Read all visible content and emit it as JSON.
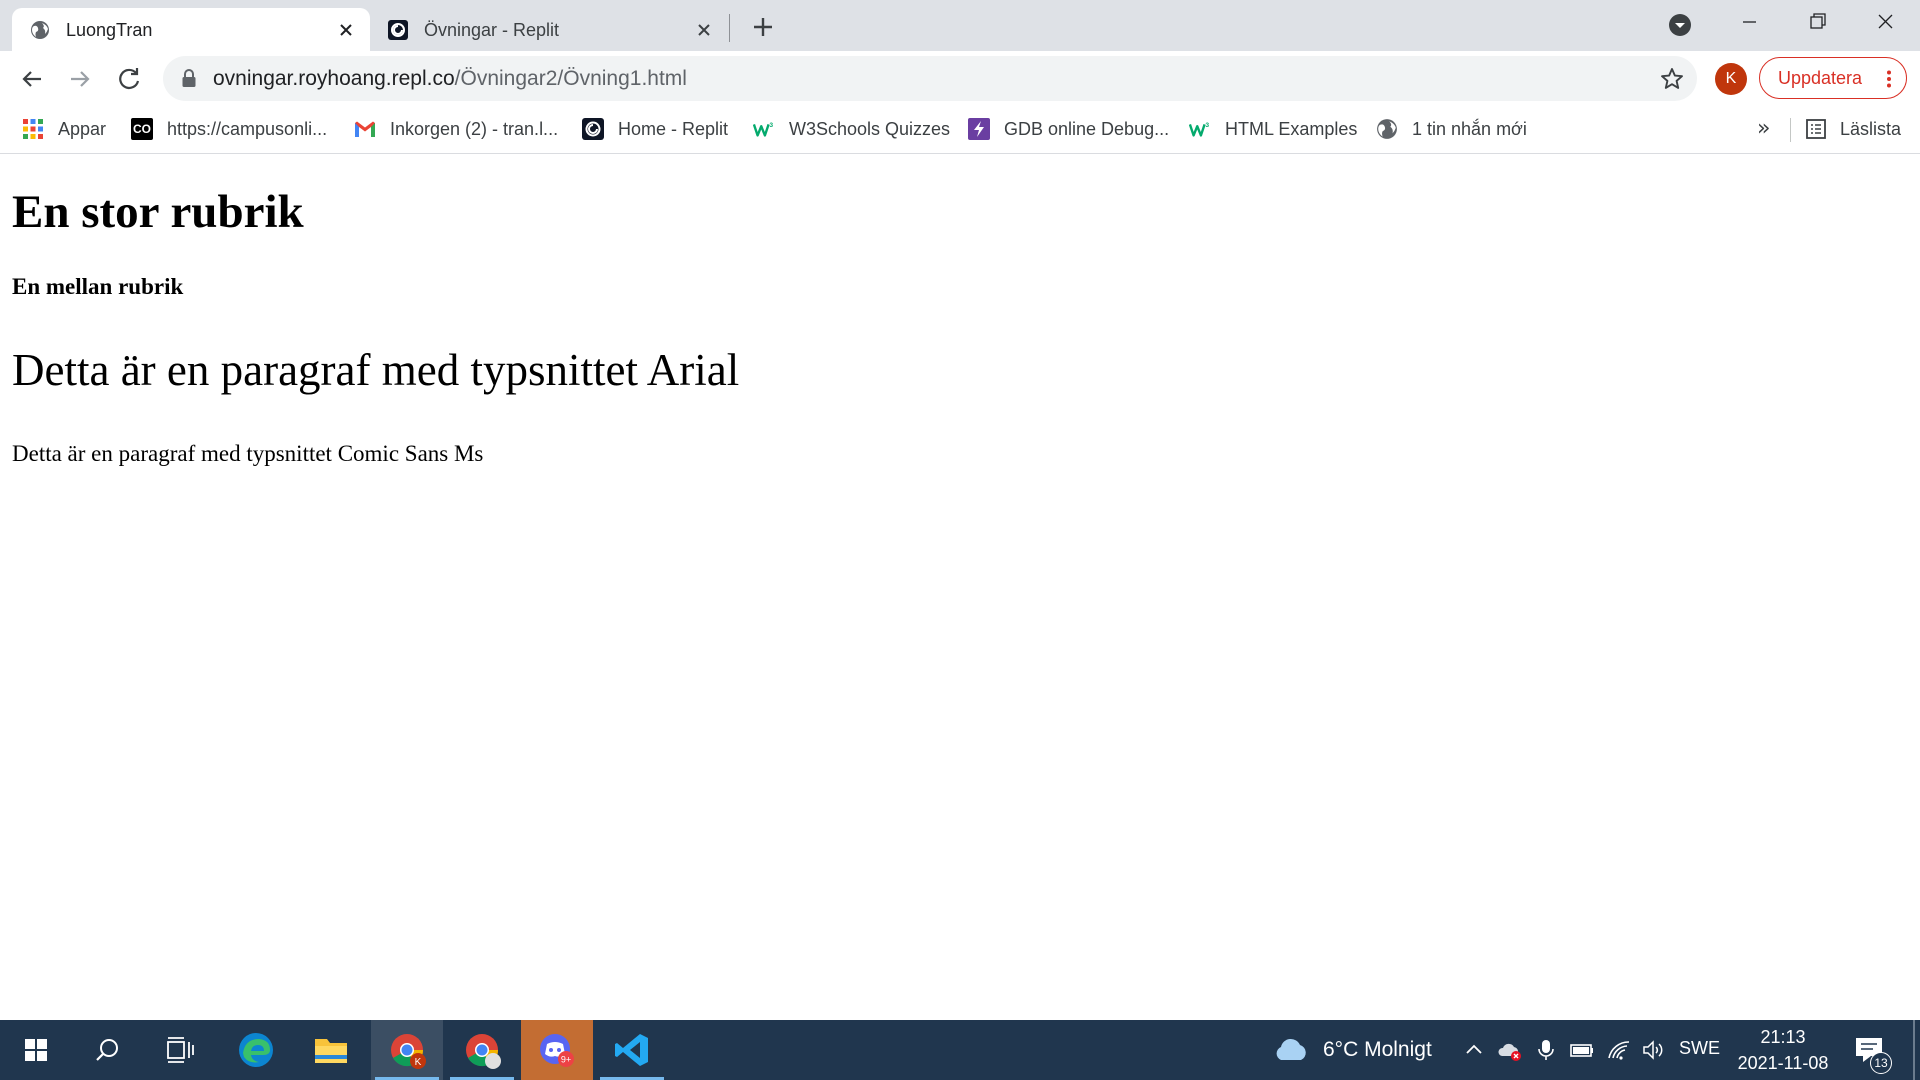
{
  "tabs": [
    {
      "title": "LuongTran",
      "active": true,
      "icon": "globe-icon"
    },
    {
      "title": "Övningar - Replit",
      "active": false,
      "icon": "replit-icon"
    }
  ],
  "address_bar": {
    "host": "ovningar.royhoang.repl.co",
    "path": "/Övningar2/Övning1.html"
  },
  "profile": {
    "initial": "K",
    "color": "#c0360c"
  },
  "update_button": {
    "label": "Uppdatera",
    "color": "#d93025"
  },
  "bookmarks": [
    {
      "label": "Appar",
      "icon": "apps-grid-icon"
    },
    {
      "label": "https://campusonli...",
      "icon": "co-icon",
      "icon_text": "CO"
    },
    {
      "label": "Inkorgen (2) - tran.l...",
      "icon": "gmail-icon"
    },
    {
      "label": "Home - Replit",
      "icon": "replit-icon"
    },
    {
      "label": "W3Schools Quizzes",
      "icon": "w3schools-icon"
    },
    {
      "label": "GDB online Debug...",
      "icon": "gdb-icon"
    },
    {
      "label": "HTML Examples",
      "icon": "w3schools-icon"
    },
    {
      "label": "1 tin nhắn mới",
      "icon": "globe-icon"
    }
  ],
  "bookmarks_overflow": "»",
  "reading_list": {
    "label": "Läslista"
  },
  "page": {
    "h1": "En stor rubrik",
    "h_mid": "En mellan rubrik",
    "p_arial": "Detta är en paragraf med typsnittet Arial",
    "p_comic": "Detta är en paragraf med typsnittet Comic Sans Ms"
  },
  "taskbar": {
    "weather": {
      "text": "6°C  Molnigt"
    },
    "language": "SWE",
    "time": "21:13",
    "date": "2021-11-08",
    "notification_count": "13",
    "chrome_badge": "K",
    "discord_badge": "9+"
  }
}
